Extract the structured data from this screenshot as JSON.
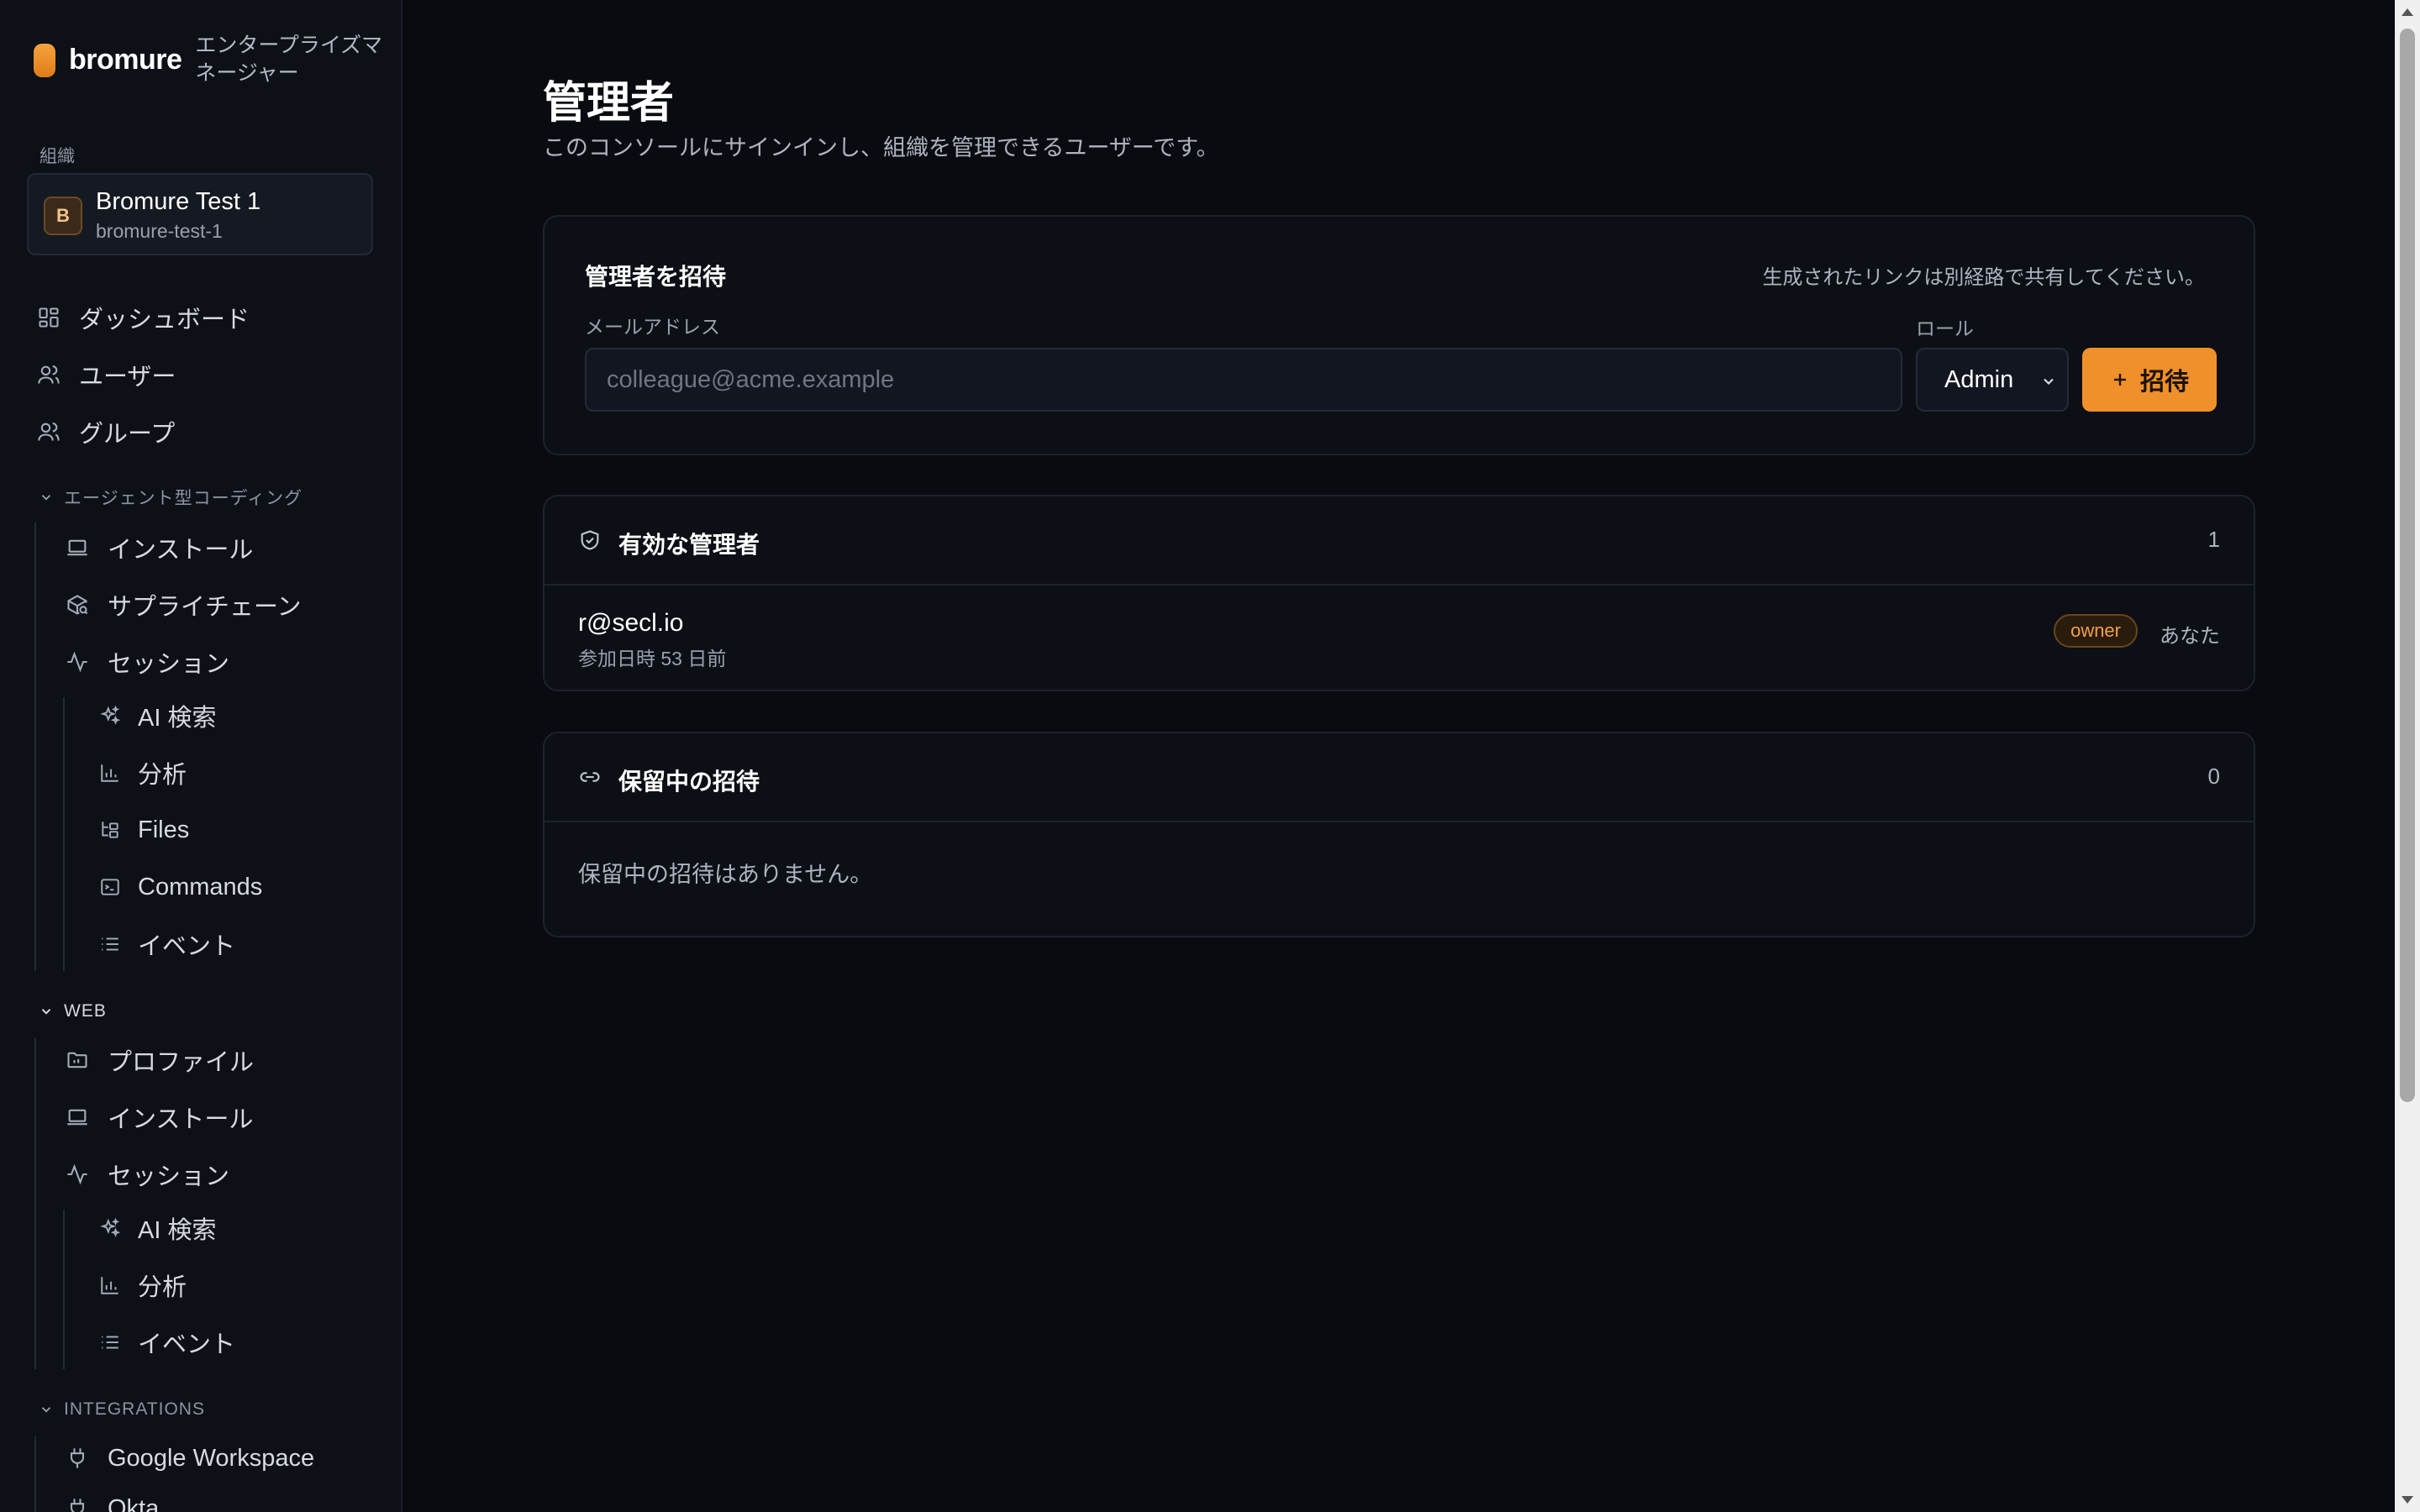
{
  "brand": {
    "name": "bromure",
    "subtitle": "エンタープライズマネージャー"
  },
  "org": {
    "label": "組織",
    "avatar": "B",
    "name": "Bromure Test 1",
    "slug": "bromure-test-1"
  },
  "nav": {
    "dashboard": "ダッシュボード",
    "users": "ユーザー",
    "groups": "グループ"
  },
  "agentic": {
    "header": "エージェント型コーディング",
    "install": "インストール",
    "supply_chain": "サプライチェーン",
    "sessions": "セッション",
    "ai_search": "AI 検索",
    "analytics": "分析",
    "files": "Files",
    "commands": "Commands",
    "events": "イベント"
  },
  "web": {
    "header": "WEB",
    "profiles": "プロファイル",
    "install": "インストール",
    "sessions": "セッション",
    "ai_search": "AI 検索",
    "analytics": "分析",
    "events": "イベント"
  },
  "integrations": {
    "header": "INTEGRATIONS",
    "google": "Google Workspace",
    "next": "Okta"
  },
  "page": {
    "title": "管理者",
    "description": "このコンソールにサインインし、組織を管理できるユーザーです。"
  },
  "invite": {
    "title": "管理者を招待",
    "hint": "生成されたリンクは別経路で共有してください。",
    "email_label": "メールアドレス",
    "email_placeholder": "colleague@acme.example",
    "email_value": "",
    "role_label": "ロール",
    "role_value": "Admin",
    "button": "招待"
  },
  "active_admins": {
    "title": "有効な管理者",
    "count": "1",
    "rows": [
      {
        "email": "r@secl.io",
        "meta": "参加日時 53 日前",
        "role": "owner",
        "you": "あなた"
      }
    ]
  },
  "pending_invites": {
    "title": "保留中の招待",
    "count": "0",
    "empty": "保留中の招待はありません。"
  },
  "colors": {
    "accent": "#f0902a",
    "background": "#090b11",
    "sidebar": "#0d1017"
  }
}
